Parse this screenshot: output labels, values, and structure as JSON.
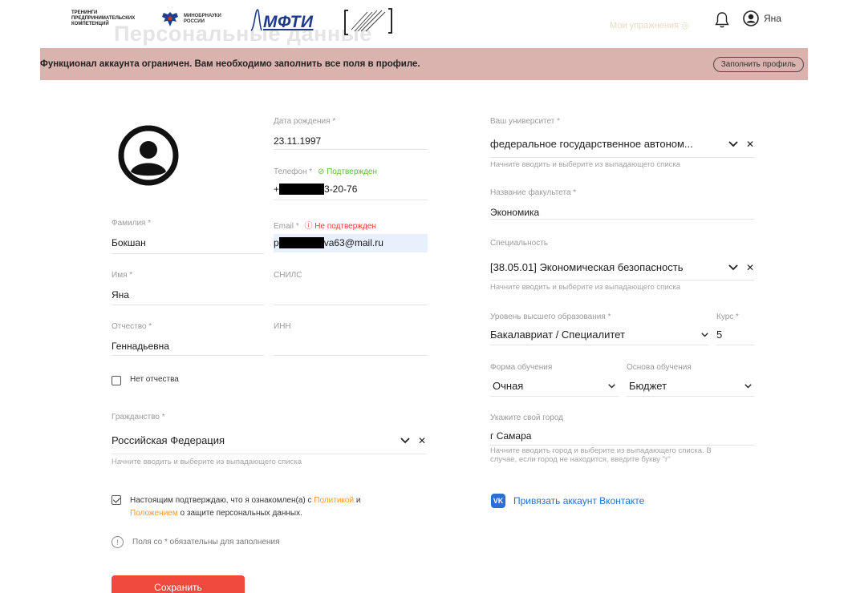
{
  "header": {
    "ghost_title": "Персональные данные",
    "logo_tpk": [
      "ТРЕНИНГИ",
      "ПРЕДПРИНИМАТЕЛЬСКИХ",
      "КОМПЕТЕНЦИЙ"
    ],
    "logo_minobrnauki": [
      "МИНОБРНАУКИ",
      "РОССИИ"
    ],
    "logo_mfti": "МФТИ",
    "ghost_link": "Мои упражнения ◎",
    "user_name": "Яна"
  },
  "banner": {
    "message": "Функционал аккаунта ограничен. Вам необходимо заполнить все поля в профиле.",
    "button": "Заполнить профиль",
    "color": "#dab2ae"
  },
  "left": {
    "last_name": {
      "label": "Фамилия *",
      "value": "Бокшан"
    },
    "first_name": {
      "label": "Имя *",
      "value": "Яна"
    },
    "patronymic": {
      "label": "Отчество *",
      "value": "Геннадьевна"
    },
    "no_patronymic": "Нет отчества",
    "citizenship": {
      "label": "Гражданство *",
      "value": "Российская Федерация",
      "hint": "Начните вводить и выберите из выпадающего списка"
    }
  },
  "middle": {
    "birth": {
      "label": "Дата рождения *",
      "value": "23.11.1997"
    },
    "phone": {
      "label": "Телефон *",
      "status": "Подтвержден",
      "value_start": "+",
      "value_end": "3-20-76"
    },
    "email": {
      "label": "Email *",
      "status": "Не подтвержден",
      "value_start": "р",
      "value_end": "va63@mail.ru"
    },
    "snils": {
      "label": "СНИЛС"
    },
    "inn": {
      "label": "ИНН"
    }
  },
  "right": {
    "university": {
      "label": "Ваш университет *",
      "value": "федеральное государственное автоном...",
      "hint": "Начните вводить и выберите из выпадающего списка"
    },
    "faculty": {
      "label": "Название факультета *",
      "value": "Экономика"
    },
    "specialty": {
      "label": "Специальность",
      "value": "[38.05.01] Экономическая безопасность",
      "hint": "Начните вводить и выберите из выпадающего списка"
    },
    "level": {
      "label": "Уровень высшего образования *",
      "value": "Бакалавриат / Специалитет"
    },
    "course": {
      "label": "Курс *",
      "value": "5"
    },
    "form": {
      "label": "Форма обучения",
      "value": "Очная"
    },
    "basis": {
      "label": "Основа обучения",
      "value": "Бюджет"
    },
    "city": {
      "label": "Укажите свой город",
      "value": "г Самара",
      "hint_1": "Начните вводить город и выберите из выпадающего списка. В",
      "hint_2": "случае, если город не находится, введите букву \"г\""
    },
    "vk": {
      "icon_text": "VK",
      "label": "Привязать аккаунт Вконтакте"
    }
  },
  "consent": {
    "part1": "Настоящим подтверждаю, что я ознакомлен(а) с ",
    "link1": "Политикой",
    "part2": " и",
    "link2": "Положением",
    "part3": " о защите персональных данных."
  },
  "required_note": "Поля со * обязательны для заполнения",
  "save_button": "Сохранить",
  "colors": {
    "save": "#f04a3e",
    "link": "#f29a36",
    "ok": "#5ebf35",
    "error": "#e03e3e",
    "vk": "#2b6fd6"
  }
}
